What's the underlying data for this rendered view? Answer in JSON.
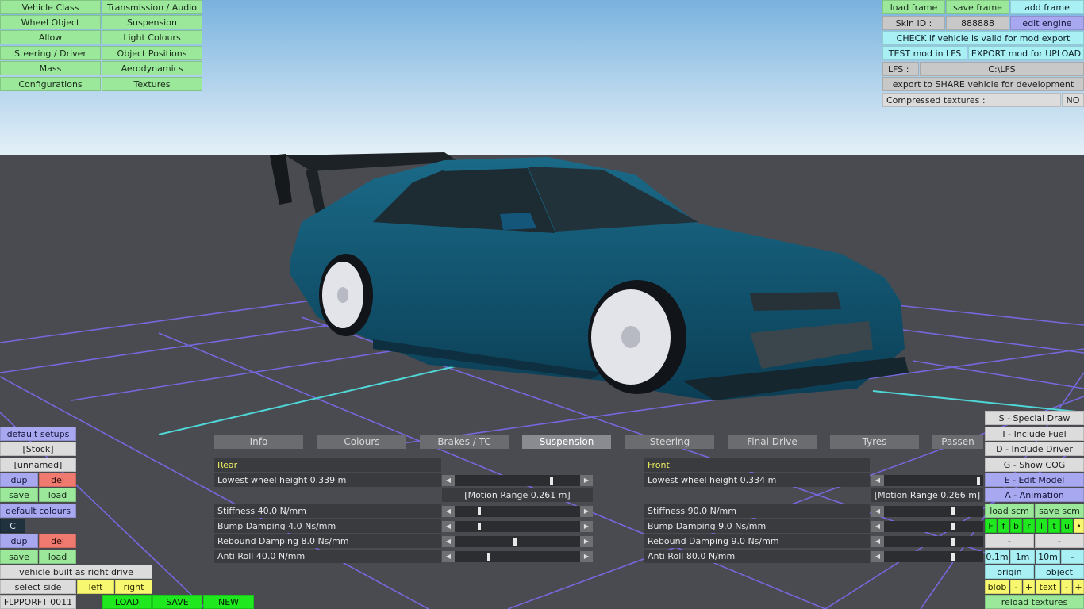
{
  "app": {
    "colors": {
      "sky_top": "#7fb6e0",
      "sky_bottom": "#e4f0f8",
      "floor": "#4a4b51",
      "grid": "#7b6fe0",
      "grid_accent": "#4fd8d8",
      "car_body": "#0e4a64"
    }
  },
  "top_left_menu": [
    [
      "Vehicle Class",
      "Transmission / Audio"
    ],
    [
      "Wheel Object",
      "Suspension"
    ],
    [
      "Allow",
      "Light Colours"
    ],
    [
      "Steering / Driver",
      "Object Positions"
    ],
    [
      "Mass",
      "Aerodynamics"
    ],
    [
      "Configurations",
      "Textures"
    ]
  ],
  "top_right": {
    "load_frame": "load frame",
    "save_frame": "save frame",
    "add_frame": "add frame",
    "skin_id_label": "Skin ID :",
    "skin_id_value": "888888",
    "edit_engine": "edit engine",
    "check_valid": "CHECK if vehicle is valid for mod export",
    "test_mod": "TEST mod in LFS",
    "export_mod": "EXPORT mod for UPLOAD",
    "lfs_label": "LFS :",
    "lfs_path": "C:\\LFS",
    "export_share": "export to SHARE vehicle for development",
    "compressed_label": "Compressed textures :",
    "compressed_value": "NO"
  },
  "bottom_left": {
    "default_setups": "default setups",
    "stock": "[Stock]",
    "unnamed": "[unnamed]",
    "dup1": "dup",
    "del1": "del",
    "save1": "save",
    "load1": "load",
    "default_colours": "default colours",
    "colour_code": "C",
    "dup2": "dup",
    "del2": "del",
    "save2": "save",
    "load2": "load",
    "right_drive": "vehicle built as right drive",
    "select_side": "select side",
    "left": "left",
    "right": "right",
    "vehicle_code": "FLPPORFT 0011",
    "load_btn": "LOAD",
    "save_btn": "SAVE",
    "new_btn": "NEW"
  },
  "bottom_right": {
    "special_draw": "S - Special Draw",
    "include_fuel": "I - Include Fuel",
    "include_driver": "D - Include Driver",
    "show_cog": "G - Show COG",
    "edit_model": "E - Edit Model",
    "animation": "A - Animation",
    "load_scm": "load scm",
    "save_scm": "save scm",
    "flags": [
      "F",
      "f",
      "b",
      "r",
      "l",
      "t",
      "u",
      "•"
    ],
    "minus1": "-",
    "minus2": "-",
    "step_01": "0.1m",
    "step_1": "1m",
    "step_10": "10m",
    "step_minus": "-",
    "origin": "origin",
    "object": "object",
    "blob": "blob",
    "blob_minus": "-",
    "blob_plus": "+",
    "text": "text",
    "text_minus": "-",
    "text_plus": "+",
    "reload_textures": "reload textures"
  },
  "tabs": [
    "Info",
    "Colours",
    "Brakes / TC",
    "Suspension",
    "Steering",
    "Final Drive",
    "Tyres",
    "Passen"
  ],
  "active_tab": "Suspension",
  "suspension": {
    "rear": {
      "title": "Rear",
      "lowest_wheel": "Lowest wheel height 0.339 m",
      "motion_range": "[Motion Range 0.261 m]",
      "stiffness": "Stiffness 40.0 N/mm",
      "bump": "Bump Damping 4.0 Ns/mm",
      "rebound": "Rebound Damping 8.0 Ns/mm",
      "anti_roll": "Anti Roll 40.0 N/mm"
    },
    "front": {
      "title": "Front",
      "lowest_wheel": "Lowest wheel height 0.334 m",
      "motion_range": "[Motion Range 0.266 m]",
      "stiffness": "Stiffness 90.0 N/mm",
      "bump": "Bump Damping 9.0 Ns/mm",
      "rebound": "Rebound Damping 9.0 Ns/mm",
      "anti_roll": "Anti Roll 80.0 N/mm"
    }
  }
}
